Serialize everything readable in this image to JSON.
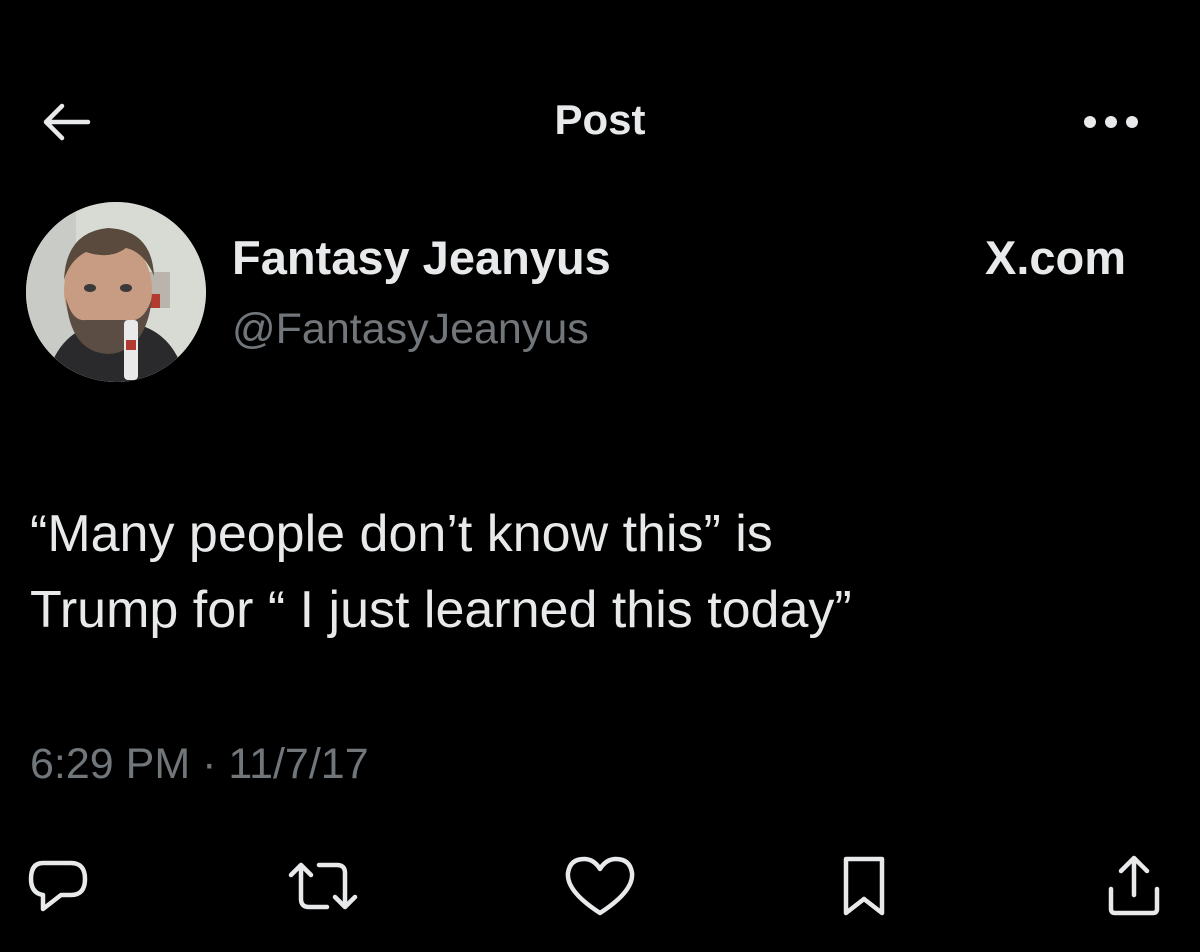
{
  "header": {
    "title": "Post",
    "back_icon": "arrow-left-icon",
    "more_icon": "more-horizontal-icon"
  },
  "author": {
    "display_name": "Fantasy Jeanyus",
    "handle": "@FantasyJeanyus",
    "avatar": "user-avatar-photo"
  },
  "watermark": "X.com",
  "post": {
    "text_lines": [
      "“Many people don’t know this” is",
      "Trump for “ I just learned this today”"
    ],
    "timestamp": "6:29 PM · 11/7/17"
  },
  "actions": [
    {
      "name": "reply",
      "icon": "reply-icon"
    },
    {
      "name": "repost",
      "icon": "repost-icon"
    },
    {
      "name": "like",
      "icon": "heart-icon"
    },
    {
      "name": "bookmark",
      "icon": "bookmark-icon"
    },
    {
      "name": "share",
      "icon": "share-icon"
    }
  ],
  "colors": {
    "background": "#000000",
    "primary_text": "#e7e9ea",
    "secondary_text": "#71767b"
  }
}
